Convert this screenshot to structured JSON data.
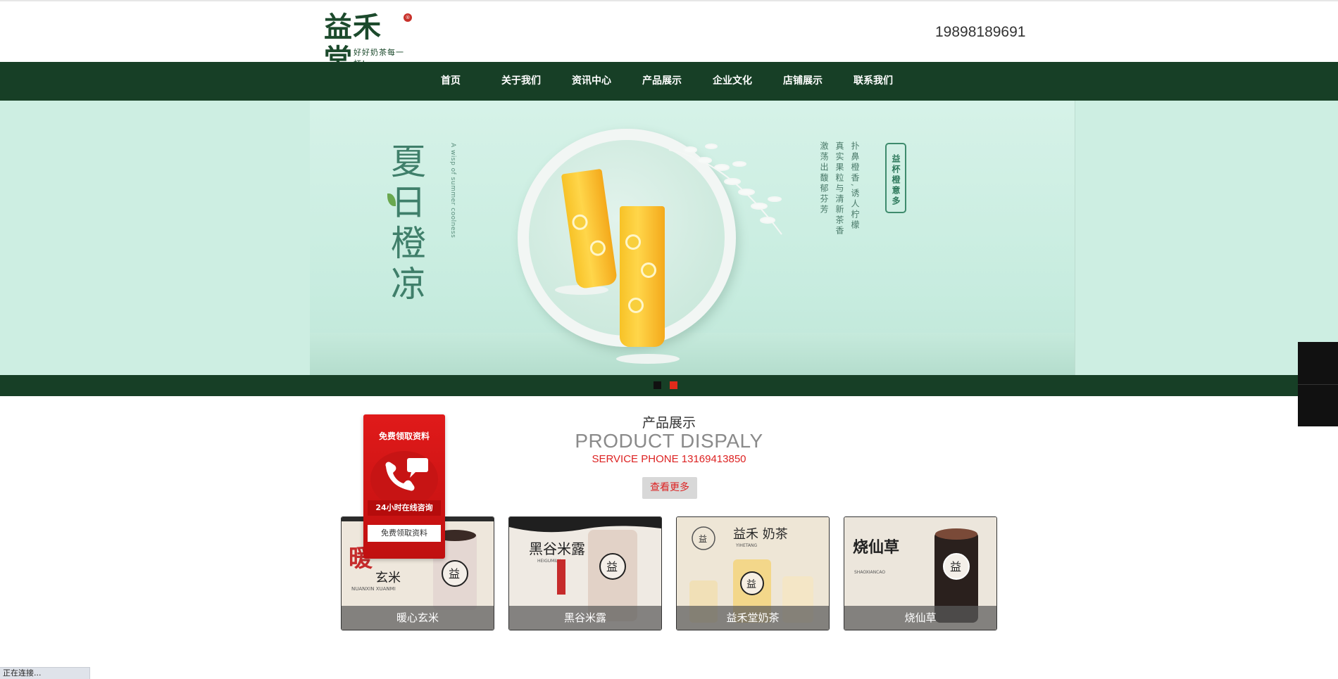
{
  "header": {
    "logo_text": "益禾堂",
    "logo_slogan": "好好奶茶每一杯!",
    "phone": "19898189691"
  },
  "nav": {
    "items": [
      {
        "label": "首页"
      },
      {
        "label": "关于我们"
      },
      {
        "label": "资讯中心"
      },
      {
        "label": "产品展示"
      },
      {
        "label": "企业文化"
      },
      {
        "label": "店铺展示"
      },
      {
        "label": "联系我们"
      }
    ]
  },
  "banner": {
    "title": "夏日橙凉",
    "subtitle": "A wisp of summer coolness",
    "poem_col1": "扑鼻橙香,诱人柠檬",
    "poem_col2": "真实果粒与清新茶香",
    "poem_col3": "激荡出馥郁芬芳",
    "tag": "益杯橙意多",
    "slide_count": 2,
    "active_slide": 2,
    "colors": {
      "bg": "#cdeee2",
      "bar": "#173f26",
      "dot_inactive": "#111111",
      "dot_active": "#e02b1b"
    }
  },
  "product_section": {
    "title": "产品展示",
    "title_en": "PRODUCT DISPALY",
    "service_phone": "SERVICE PHONE 13169413850",
    "more_button": "查看更多",
    "products": [
      {
        "name": "暖心玄米",
        "art_text": "玄米",
        "art_pinyin": "NUANXIN XUANMI"
      },
      {
        "name": "黑谷米露",
        "art_text": "黑谷米露",
        "art_pinyin": "HEIGUMILU"
      },
      {
        "name": "益禾堂奶茶",
        "art_text": "益禾 奶茶",
        "art_pinyin": "YIHETANG"
      },
      {
        "name": "烧仙草",
        "art_text": "烧仙草",
        "art_pinyin": "SHAOXIANCAO"
      }
    ]
  },
  "float_card": {
    "top_label": "免费领取资料",
    "mid_label": "24小时在线咨询",
    "button_label": "免费领取资料"
  },
  "status_bar": {
    "text": "正在连接..."
  },
  "colors": {
    "brand_green": "#173f26",
    "accent_red": "#dd2222"
  }
}
